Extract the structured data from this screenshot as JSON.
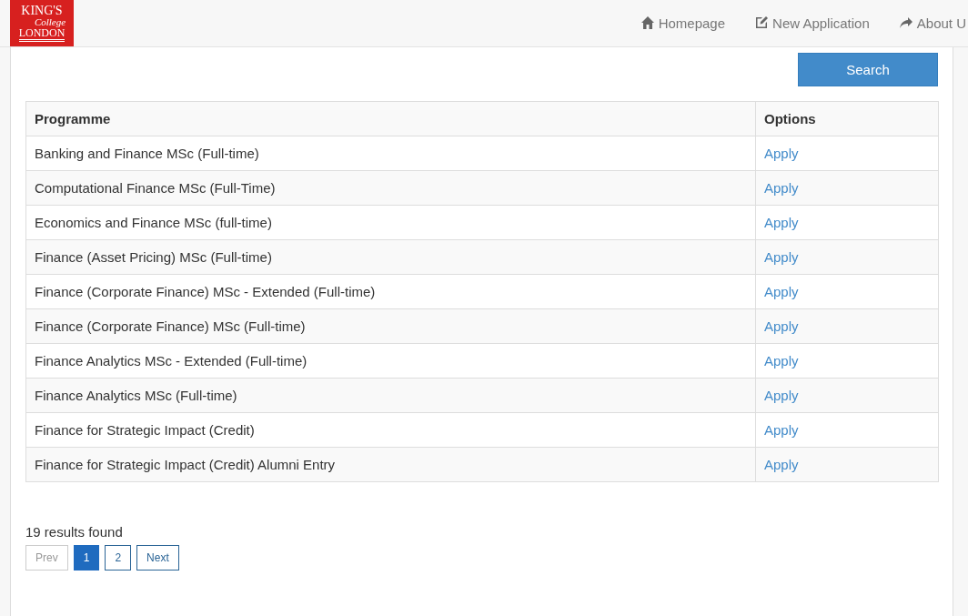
{
  "logo": {
    "lines": [
      "KING'S",
      "College",
      "LONDON"
    ]
  },
  "nav": [
    {
      "kind": "home",
      "label": "Homepage"
    },
    {
      "kind": "edit",
      "label": "New Application"
    },
    {
      "kind": "share",
      "label": "About U"
    }
  ],
  "search_button": "Search",
  "table": {
    "columns": [
      "Programme",
      "Options"
    ],
    "rows": [
      {
        "programme": "Banking and Finance MSc (Full-time)",
        "option": "Apply"
      },
      {
        "programme": "Computational Finance MSc (Full-Time)",
        "option": "Apply"
      },
      {
        "programme": "Economics and Finance MSc (full-time)",
        "option": "Apply"
      },
      {
        "programme": "Finance (Asset Pricing) MSc (Full-time)",
        "option": "Apply"
      },
      {
        "programme": "Finance (Corporate Finance) MSc - Extended (Full-time)",
        "option": "Apply"
      },
      {
        "programme": "Finance (Corporate Finance) MSc (Full-time)",
        "option": "Apply"
      },
      {
        "programme": "Finance Analytics MSc - Extended (Full-time)",
        "option": "Apply"
      },
      {
        "programme": "Finance Analytics MSc (Full-time)",
        "option": "Apply"
      },
      {
        "programme": "Finance for Strategic Impact (Credit)",
        "option": "Apply"
      },
      {
        "programme": "Finance for Strategic Impact (Credit) Alumni Entry",
        "option": "Apply"
      }
    ]
  },
  "results": "19 results found",
  "pagination": [
    {
      "label": "Prev",
      "disabled": true,
      "selected": false
    },
    {
      "label": "1",
      "disabled": false,
      "selected": true
    },
    {
      "label": "2",
      "disabled": false,
      "selected": false
    },
    {
      "label": "Next",
      "disabled": false,
      "selected": false
    }
  ]
}
